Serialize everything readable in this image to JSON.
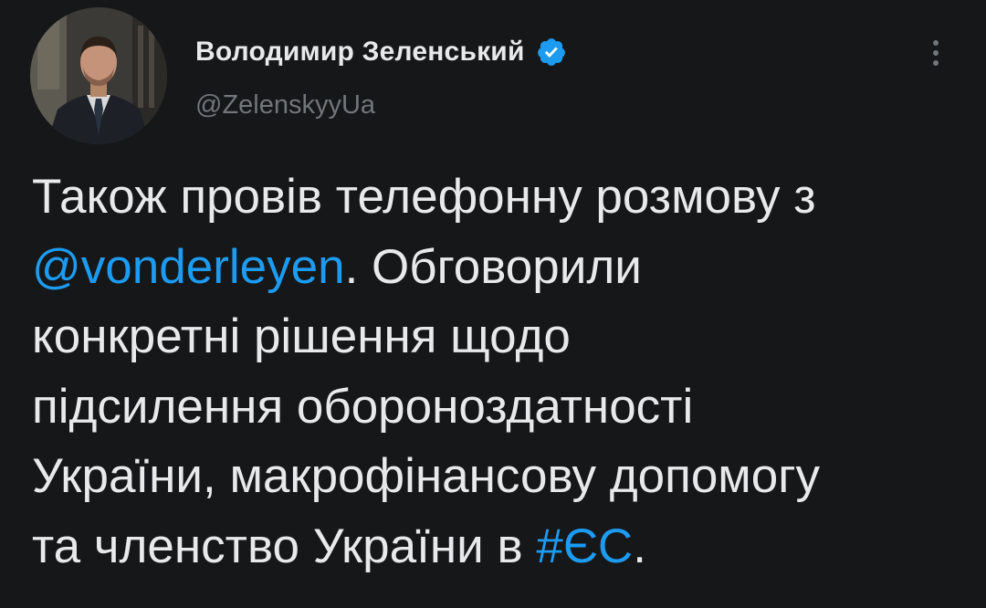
{
  "author": {
    "display_name": "Володимир Зеленський",
    "handle": "@ZelenskyyUa",
    "verified_icon": "verified-badge-icon",
    "avatar_icon": "profile-photo"
  },
  "menu": {
    "icon": "more-options-icon"
  },
  "tweet": {
    "line1": "Також провів телефонну розмову з",
    "mention": "@vonderleyen",
    "line2_rest": ". Обговорили",
    "line3": "конкретні рішення щодо",
    "line4": "підсилення обороноздатності",
    "line5": "України, макрофінансову допомогу",
    "line6_start": "та членство України в ",
    "hashtag": "#ЄС",
    "line6_end": "."
  },
  "colors": {
    "background": "#151719",
    "text": "#e7e9ea",
    "secondary": "#71767b",
    "link": "#1d9bf0"
  }
}
